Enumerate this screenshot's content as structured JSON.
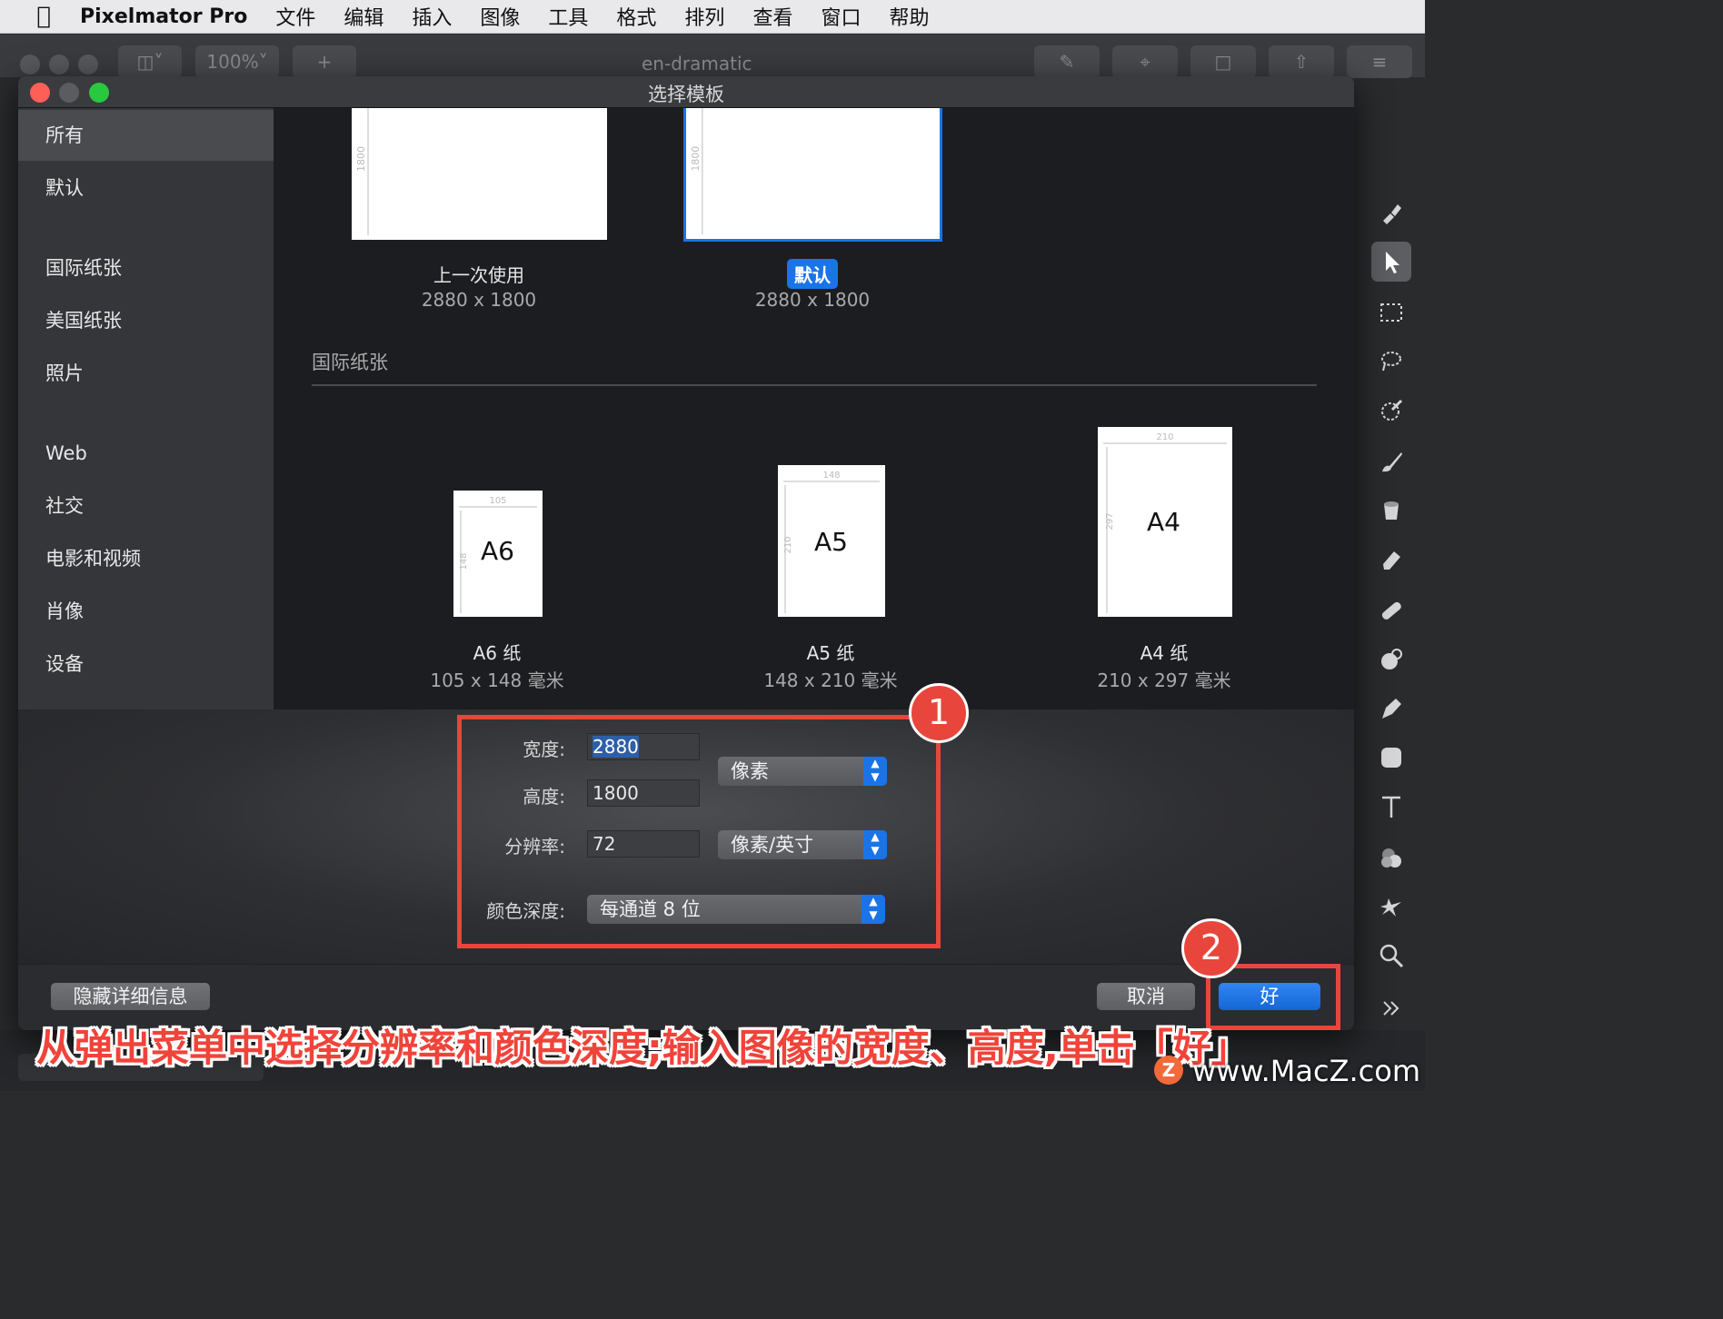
{
  "menubar": {
    "app_name": "Pixelmator Pro",
    "items": [
      "文件",
      "编辑",
      "插入",
      "图像",
      "工具",
      "格式",
      "排列",
      "查看",
      "窗口",
      "帮助"
    ]
  },
  "toolbar": {
    "zoom": "100%",
    "add": "+",
    "document_title": "en-dramatic"
  },
  "dialog": {
    "title": "选择模板",
    "sidebar": [
      "所有",
      "默认",
      "国际纸张",
      "美国纸张",
      "照片",
      "Web",
      "社交",
      "电影和视频",
      "肖像",
      "设备"
    ],
    "templates_top": [
      {
        "name": "上一次使用",
        "size": "2880 x 1800",
        "dim": "1800"
      },
      {
        "name": "默认",
        "size": "2880 x 1800",
        "dim": "1800"
      }
    ],
    "section_title": "国际纸张",
    "paper_templates": [
      {
        "label": "A6",
        "name": "A6 纸",
        "size": "105 x 148 毫米",
        "w": "105",
        "h": "148"
      },
      {
        "label": "A5",
        "name": "A5 纸",
        "size": "148 x 210 毫米",
        "w": "148",
        "h": "210"
      },
      {
        "label": "A4",
        "name": "A4 纸",
        "size": "210 x 297 毫米",
        "w": "210",
        "h": "297"
      }
    ],
    "details": {
      "width_label": "宽度:",
      "width_value": "2880",
      "height_label": "高度:",
      "height_value": "1800",
      "resolution_label": "分辨率:",
      "resolution_value": "72",
      "unit_popup": "像素",
      "resolution_unit_popup": "像素/英寸",
      "color_depth_label": "颜色深度:",
      "color_depth_popup": "每通道 8 位"
    },
    "buttons": {
      "hide_details": "隐藏详细信息",
      "cancel": "取消",
      "ok": "好"
    }
  },
  "annotations": {
    "badge_1": "1",
    "badge_2": "2",
    "caption": "从弹出菜单中选择分辨率和颜色深度;输入图像的宽度、高度,单击「好」",
    "watermark": "www.MacZ.com",
    "watermark_logo": "Z"
  },
  "colors": {
    "accent": "#1a74e8",
    "annotation_red": "#e8463c"
  }
}
